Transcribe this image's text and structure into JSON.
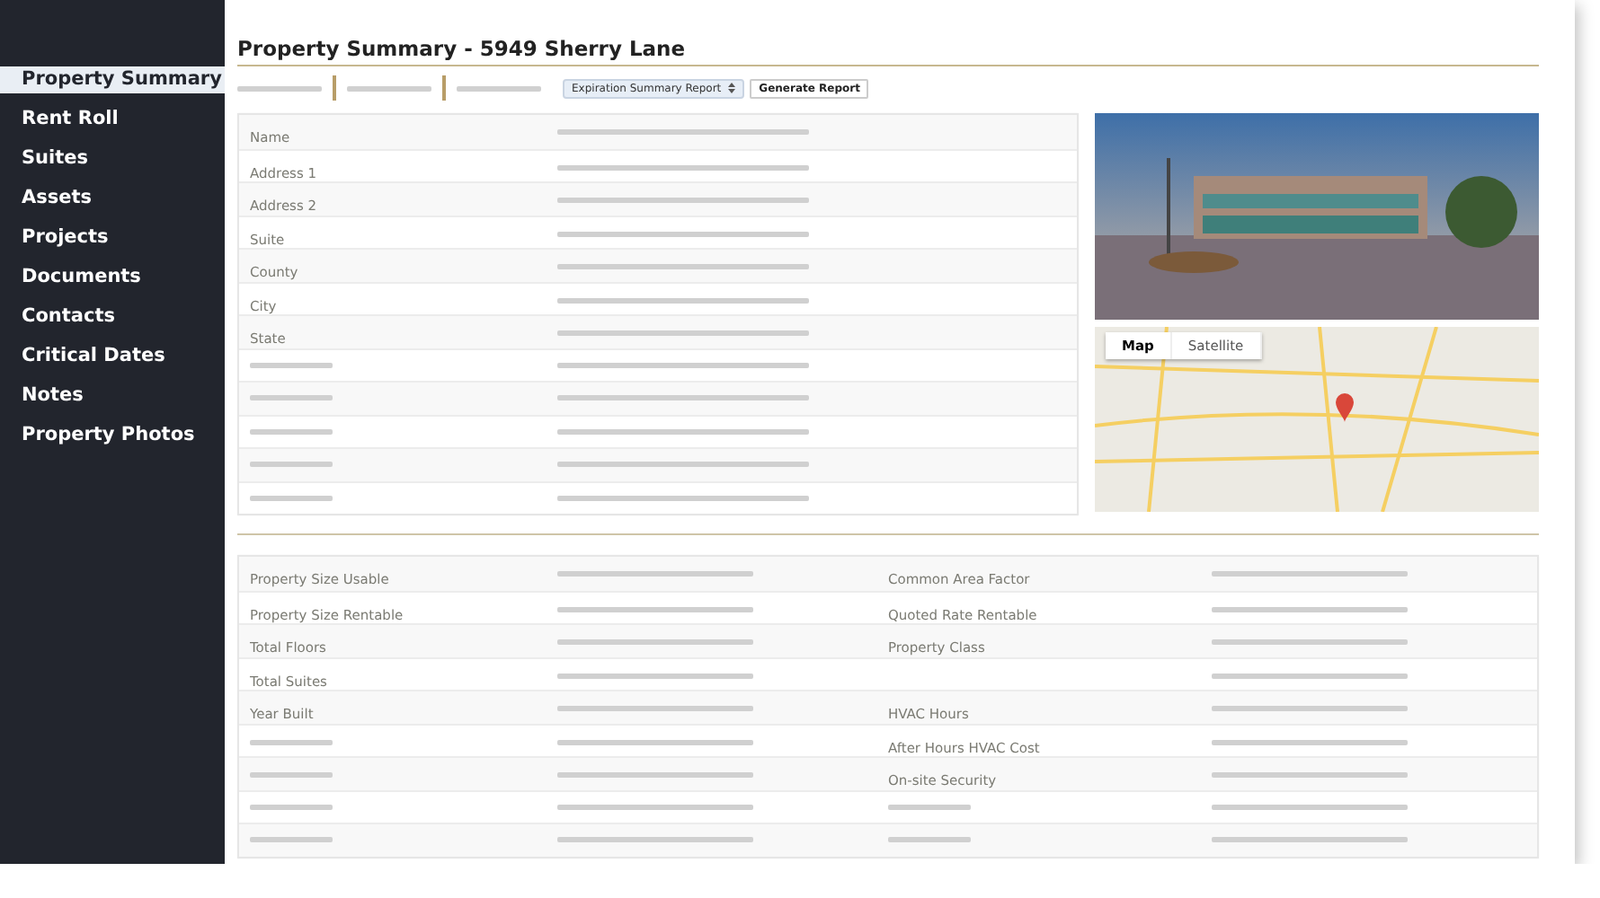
{
  "sidebar": {
    "items": [
      {
        "label": "Property Summary",
        "selected": true
      },
      {
        "label": "Rent Roll",
        "selected": false
      },
      {
        "label": "Suites",
        "selected": false
      },
      {
        "label": "Assets",
        "selected": false
      },
      {
        "label": "Projects",
        "selected": false
      },
      {
        "label": "Documents",
        "selected": false
      },
      {
        "label": "Contacts",
        "selected": false
      },
      {
        "label": "Critical Dates",
        "selected": false
      },
      {
        "label": "Notes",
        "selected": false
      },
      {
        "label": "Property Photos",
        "selected": false
      }
    ]
  },
  "title": "Property Summary - 5949 Sherry Lane",
  "toolbar": {
    "report_select": "Expiration Summary Report",
    "button": "Generate Report"
  },
  "details": {
    "rows": [
      {
        "kind": "label",
        "label": "Name"
      },
      {
        "kind": "label",
        "label": "Address 1"
      },
      {
        "kind": "label",
        "label": "Address 2"
      },
      {
        "kind": "label",
        "label": "Suite"
      },
      {
        "kind": "label",
        "label": "County"
      },
      {
        "kind": "label",
        "label": "City"
      },
      {
        "kind": "label",
        "label": "State"
      },
      {
        "kind": "placeholder"
      },
      {
        "kind": "placeholder"
      },
      {
        "kind": "placeholder"
      },
      {
        "kind": "placeholder"
      },
      {
        "kind": "placeholder"
      }
    ]
  },
  "map": {
    "tabs": [
      {
        "label": "Map",
        "selected": true
      },
      {
        "label": "Satellite",
        "selected": false
      }
    ]
  },
  "attributes": {
    "rows": [
      {
        "left": {
          "kind": "label",
          "label": "Property Size Usable"
        },
        "right": {
          "kind": "label",
          "label": "Common Area Factor"
        }
      },
      {
        "left": {
          "kind": "label",
          "label": "Property Size Rentable"
        },
        "right": {
          "kind": "label",
          "label": "Quoted Rate Rentable"
        }
      },
      {
        "left": {
          "kind": "label",
          "label": "Total Floors"
        },
        "right": {
          "kind": "label",
          "label": "Property Class"
        }
      },
      {
        "left": {
          "kind": "label",
          "label": "Total Suites"
        },
        "right": {
          "kind": "none"
        }
      },
      {
        "left": {
          "kind": "label",
          "label": "Year Built"
        },
        "right": {
          "kind": "label",
          "label": "HVAC Hours"
        }
      },
      {
        "left": {
          "kind": "placeholder"
        },
        "right": {
          "kind": "label",
          "label": "After Hours HVAC Cost"
        }
      },
      {
        "left": {
          "kind": "placeholder"
        },
        "right": {
          "kind": "label",
          "label": "On-site Security"
        }
      },
      {
        "left": {
          "kind": "placeholder"
        },
        "right": {
          "kind": "placeholder"
        }
      },
      {
        "left": {
          "kind": "placeholder"
        },
        "right": {
          "kind": "placeholder"
        }
      }
    ]
  }
}
